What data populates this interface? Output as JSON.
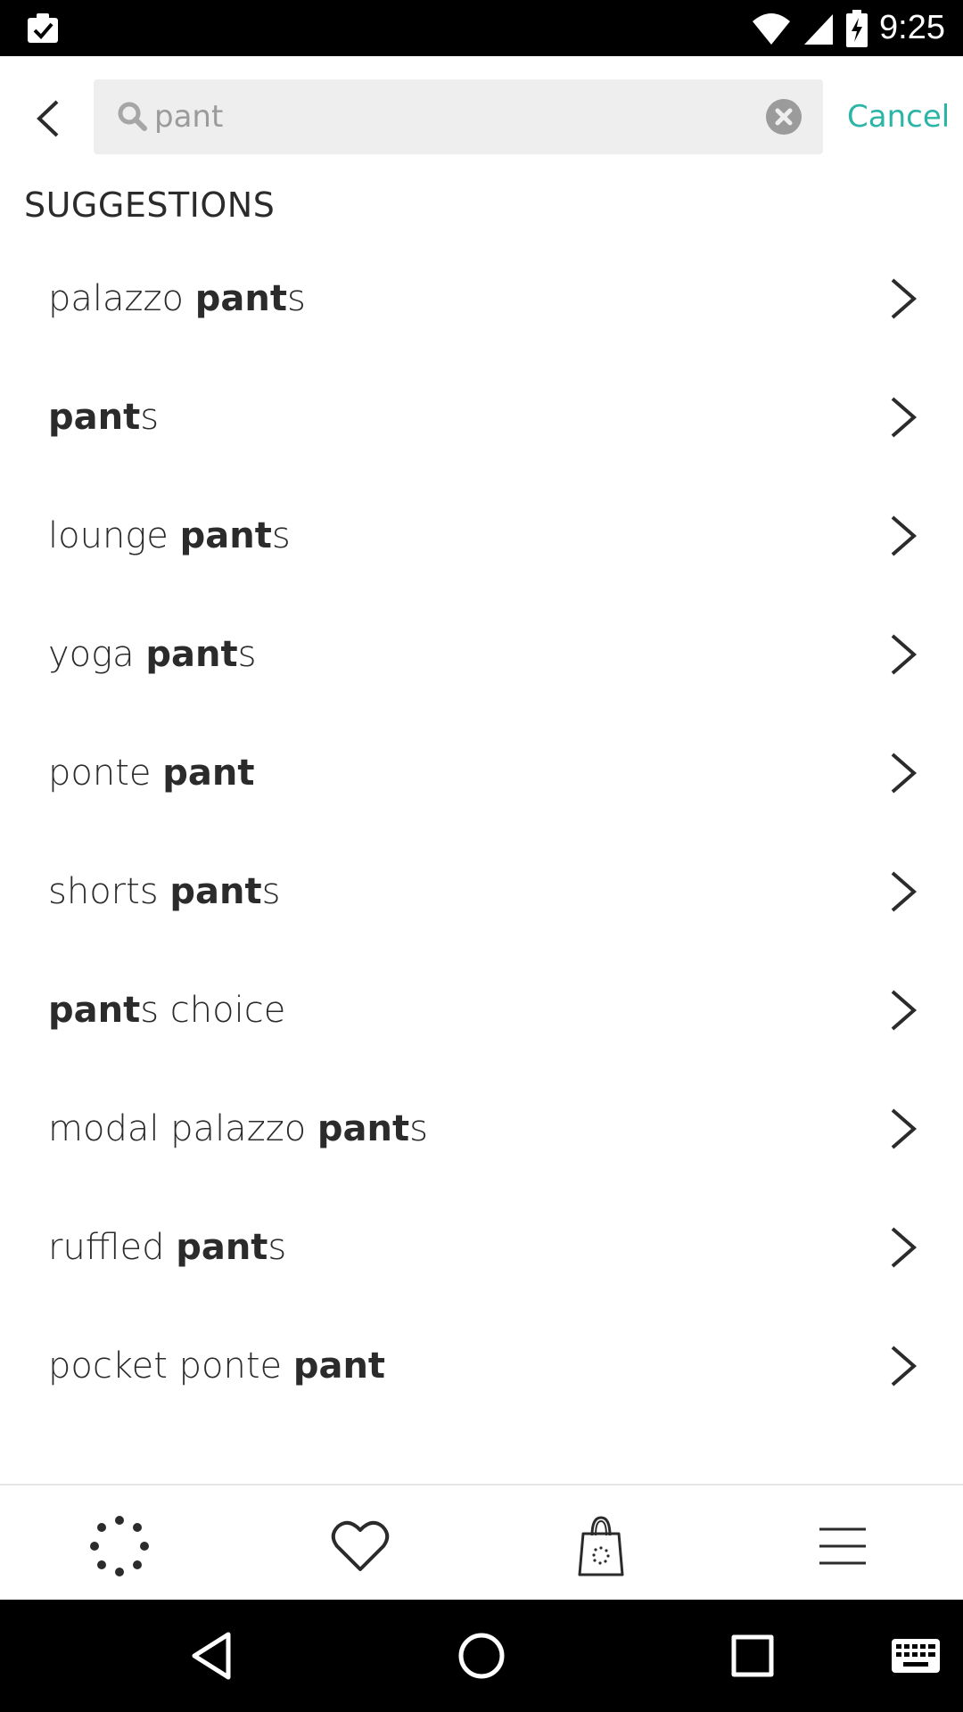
{
  "status_bar": {
    "time": "9:25"
  },
  "search": {
    "value": "pant",
    "cancel_label": "Cancel"
  },
  "suggestions_title": "SUGGESTIONS",
  "suggestions": [
    {
      "pre": "palazzo ",
      "match": "pant",
      "post": "s"
    },
    {
      "pre": "",
      "match": "pant",
      "post": "s"
    },
    {
      "pre": "lounge ",
      "match": "pant",
      "post": "s"
    },
    {
      "pre": "yoga ",
      "match": "pant",
      "post": "s"
    },
    {
      "pre": "ponte ",
      "match": "pant",
      "post": ""
    },
    {
      "pre": "shorts ",
      "match": "pant",
      "post": "s"
    },
    {
      "pre": "",
      "match": "pant",
      "post": "s choice"
    },
    {
      "pre": "modal palazzo ",
      "match": "pant",
      "post": "s"
    },
    {
      "pre": "ruffled ",
      "match": "pant",
      "post": "s"
    },
    {
      "pre": "pocket ponte ",
      "match": "pant",
      "post": ""
    }
  ],
  "bottom_nav": {
    "items": [
      "home-dots-icon",
      "heart-icon",
      "shopping-bag-icon",
      "menu-icon"
    ]
  },
  "system_nav": {
    "items": [
      "back-triangle-icon",
      "home-circle-icon",
      "recents-square-icon",
      "keyboard-icon"
    ]
  },
  "colors": {
    "accent": "#2bb5a7",
    "text": "#2b2b2b",
    "search_bg": "#eeeeee",
    "placeholder": "#9b9b9b"
  }
}
